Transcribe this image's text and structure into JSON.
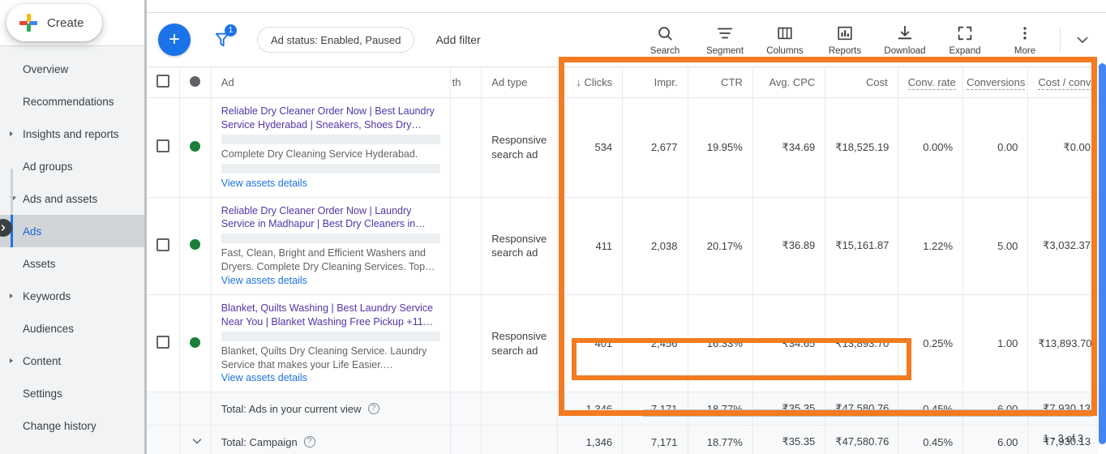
{
  "sidebar": {
    "create_button": "Create",
    "items": [
      {
        "label": "Overview",
        "name": "overview",
        "expandable": false,
        "active": false
      },
      {
        "label": "Recommendations",
        "name": "recommendations",
        "expandable": false,
        "active": false
      },
      {
        "label": "Insights and reports",
        "name": "insights-and-reports",
        "expandable": true,
        "expanded": false,
        "active": false
      },
      {
        "label": "Ad groups",
        "name": "ad-groups",
        "expandable": false,
        "active": false
      },
      {
        "label": "Ads and assets",
        "name": "ads-and-assets",
        "expandable": true,
        "expanded": true,
        "active": false
      },
      {
        "label": "Ads",
        "name": "ads",
        "expandable": false,
        "active": true,
        "sub": true
      },
      {
        "label": "Assets",
        "name": "assets",
        "expandable": false,
        "active": false,
        "sub": true
      },
      {
        "label": "Keywords",
        "name": "keywords",
        "expandable": true,
        "expanded": false,
        "active": false
      },
      {
        "label": "Audiences",
        "name": "audiences",
        "expandable": false,
        "active": false
      },
      {
        "label": "Content",
        "name": "content",
        "expandable": true,
        "expanded": false,
        "active": false
      },
      {
        "label": "Settings",
        "name": "settings",
        "expandable": false,
        "active": false
      },
      {
        "label": "Change history",
        "name": "change-history",
        "expandable": false,
        "active": false
      }
    ]
  },
  "toolbar": {
    "add_button": "+",
    "filter_badge": "1",
    "status_chip": "Ad status: Enabled, Paused",
    "add_filter": "Add filter",
    "actions": [
      {
        "label": "Search",
        "icon": "search-icon"
      },
      {
        "label": "Segment",
        "icon": "segment-icon"
      },
      {
        "label": "Columns",
        "icon": "columns-icon"
      },
      {
        "label": "Reports",
        "icon": "reports-icon"
      },
      {
        "label": "Download",
        "icon": "download-icon"
      },
      {
        "label": "Expand",
        "icon": "expand-icon"
      },
      {
        "label": "More",
        "icon": "more-vert-icon"
      }
    ]
  },
  "table": {
    "headers": {
      "ad": "Ad",
      "strength": "th",
      "ad_type": "Ad type",
      "clicks": "Clicks",
      "impr": "Impr.",
      "ctr": "CTR",
      "avg_cpc": "Avg. CPC",
      "cost": "Cost",
      "conv_rate": "Conv. rate",
      "conversions": "Conversions",
      "cost_per_conv": "Cost / conv."
    },
    "sort_indicator": "↓",
    "rows": [
      {
        "headline": "Reliable Dry Cleaner Order Now | Best Laundry Service Hyderabad | Sneakers, Shoes Dry…",
        "description": "Complete Dry Cleaning Service Hyderabad.",
        "assets_link": "View assets details",
        "ad_type": "Responsive search ad",
        "clicks": "534",
        "impr": "2,677",
        "ctr": "19.95%",
        "avg_cpc": "₹34.69",
        "cost": "₹18,525.19",
        "conv_rate": "0.00%",
        "conversions": "0.00",
        "cost_per_conv": "₹0.00"
      },
      {
        "headline": "Reliable Dry Cleaner Order Now | Laundry Service in Madhapur | Best Dry Cleaners in…",
        "description": "Fast, Clean, Bright and Efficient Washers and Dryers. Complete Dry Cleaning Services. Top…",
        "assets_link": "View assets details",
        "ad_type": "Responsive search ad",
        "clicks": "411",
        "impr": "2,038",
        "ctr": "20.17%",
        "avg_cpc": "₹36.89",
        "cost": "₹15,161.87",
        "conv_rate": "1.22%",
        "conversions": "5.00",
        "cost_per_conv": "₹3,032.37"
      },
      {
        "headline": "Blanket, Quilts Washing | Best Laundry Service Near You | Blanket Washing Free Pickup  +11…",
        "description": "Blanket, Quilts Dry Cleaning Service. Laundry Service that makes your Life Easier.…",
        "assets_link": "View assets details",
        "ad_type": "Responsive search ad",
        "clicks": "401",
        "impr": "2,456",
        "ctr": "16.33%",
        "avg_cpc": "₹34.65",
        "cost": "₹13,893.70",
        "conv_rate": "0.25%",
        "conversions": "1.00",
        "cost_per_conv": "₹13,893.70"
      }
    ],
    "totals": [
      {
        "label": "Total: Ads in your current view",
        "has_chevron": false,
        "clicks": "1,346",
        "impr": "7,171",
        "ctr": "18.77%",
        "avg_cpc": "₹35.35",
        "cost": "₹47,580.76",
        "conv_rate": "0.45%",
        "conversions": "6.00",
        "cost_per_conv": "₹7,930.13"
      },
      {
        "label": "Total: Campaign",
        "has_chevron": true,
        "clicks": "1,346",
        "impr": "7,171",
        "ctr": "18.77%",
        "avg_cpc": "₹35.35",
        "cost": "₹47,580.76",
        "conv_rate": "0.45%",
        "conversions": "6.00",
        "cost_per_conv": "₹7,930.13"
      }
    ]
  },
  "pagination": "1 - 3 of 3",
  "colors": {
    "accent_blue": "#1a73e8",
    "highlight_orange": "#f47b20",
    "status_green": "#188038",
    "headline_purple": "#5235a8"
  }
}
